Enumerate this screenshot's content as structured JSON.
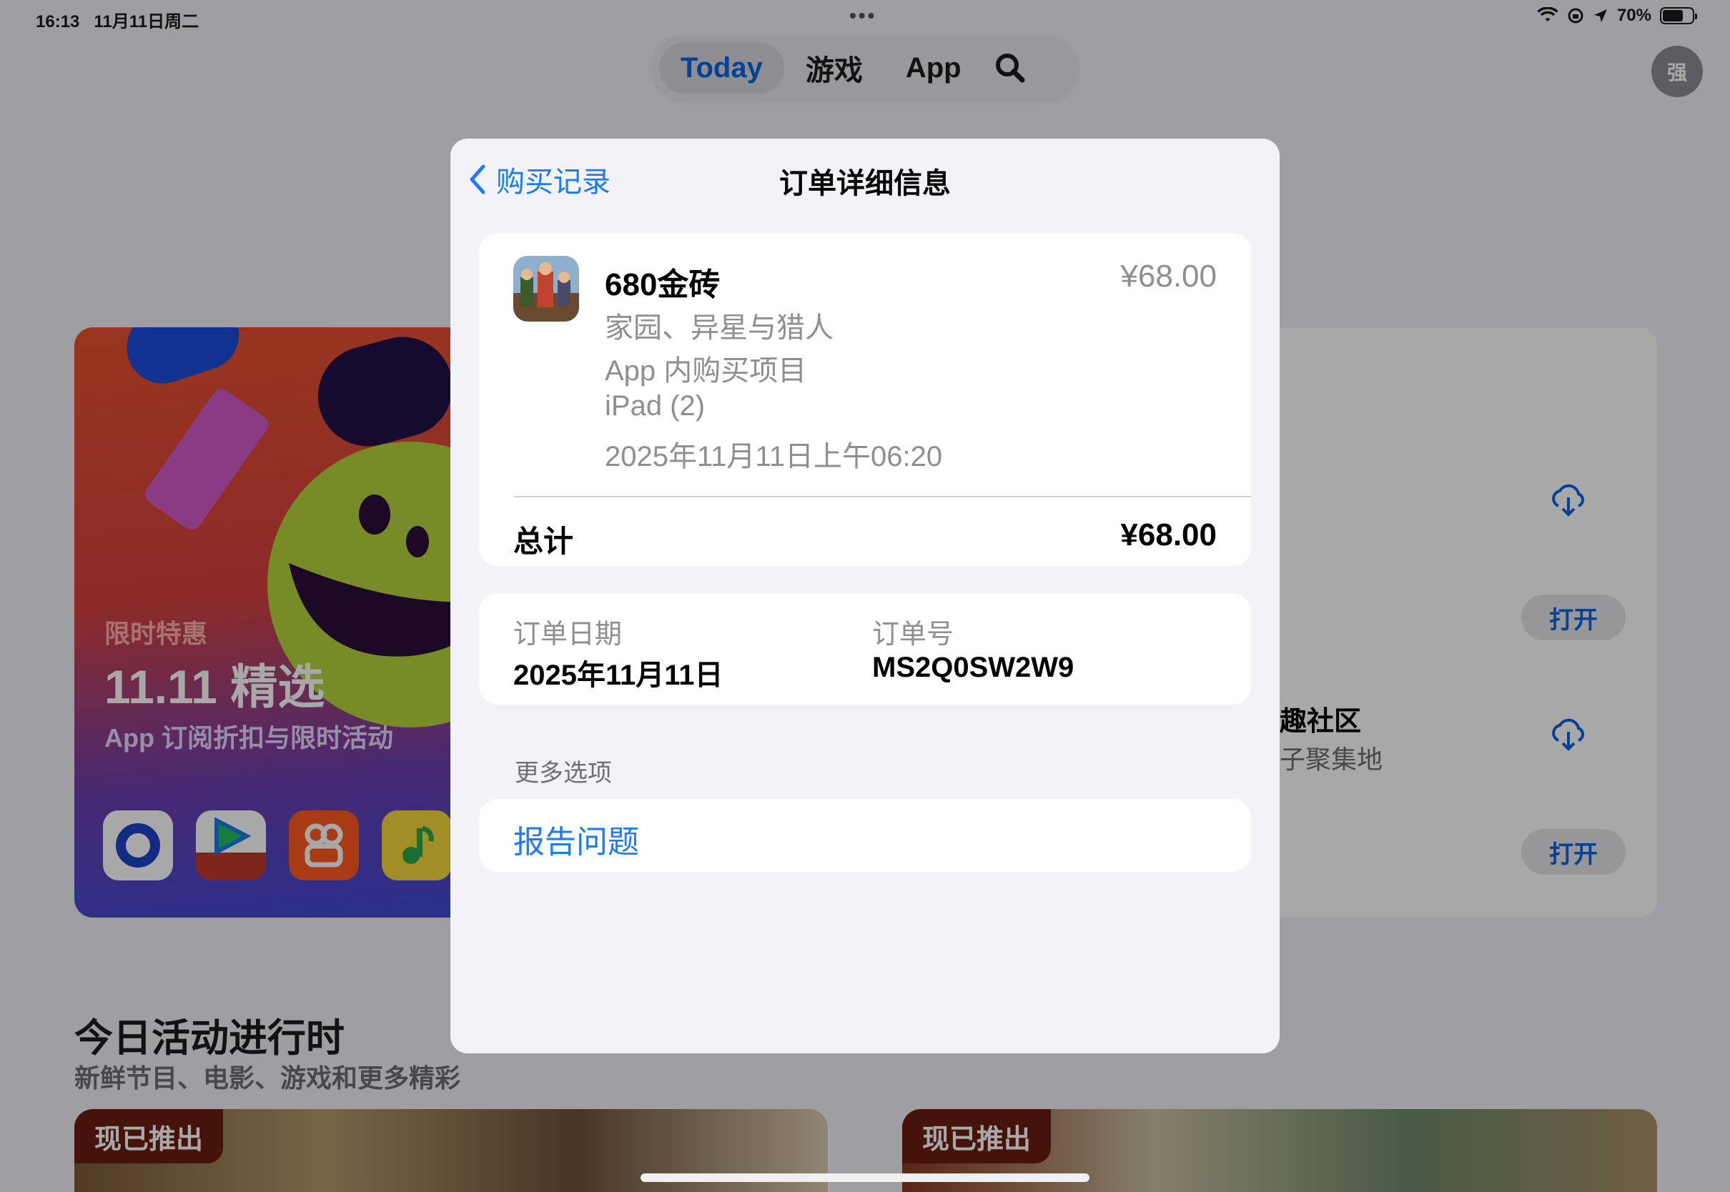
{
  "status_bar": {
    "time": "16:13",
    "date": "11月11日周二",
    "battery": "70%",
    "battery_level": 0.7
  },
  "top_tabs": [
    {
      "label": "Today",
      "active": true
    },
    {
      "label": "游戏",
      "active": false
    },
    {
      "label": "App",
      "active": false
    }
  ],
  "search_icon": "search-icon",
  "account": {
    "avatar_text": "强"
  },
  "promo": {
    "kicker": "限时特惠",
    "title": "11.11 精选",
    "subtitle": "App 订阅折扣与限时活动"
  },
  "right_card": {
    "open_label": "打开",
    "title_fragment": "趣社区",
    "subtitle_fragment": "子聚集地"
  },
  "section": {
    "title": "今日活动进行时",
    "subtitle": "新鲜节目、电影、游戏和更多精彩"
  },
  "stories": [
    {
      "badge": "现已推出"
    },
    {
      "badge": "现已推出"
    }
  ],
  "sheet": {
    "back_label": "购买记录",
    "title": "订单详细信息",
    "item": {
      "name": "680金砖",
      "price": "¥68.00",
      "app": "家园、异星与猎人",
      "type": "App 内购买项目",
      "device": "iPad (2)",
      "datetime": "2025年11月11日上午06:20"
    },
    "total_label": "总计",
    "total_value": "¥68.00",
    "order_date_label": "订单日期",
    "order_date_value": "2025年11月11日",
    "order_no_label": "订单号",
    "order_no_value": "MS2Q0SW2W9",
    "more_options_label": "更多选项",
    "report_label": "报告问题"
  },
  "colors": {
    "accent": "#1b7cf5",
    "sheet_bg": "#f2f2f7",
    "secondary_text": "#8e8e93"
  }
}
